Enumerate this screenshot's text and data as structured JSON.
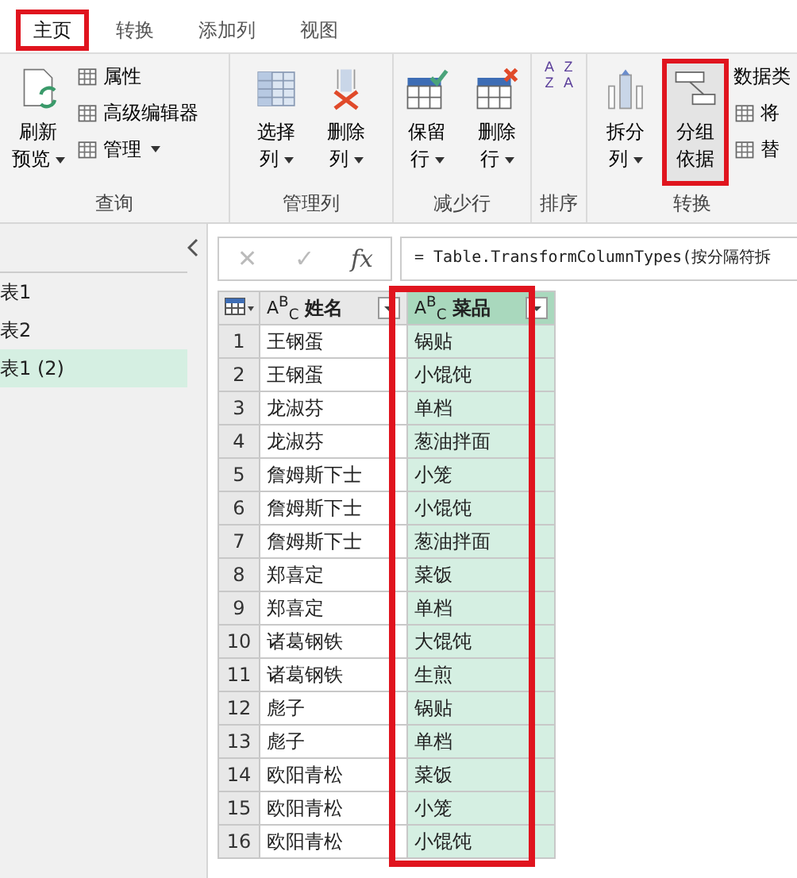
{
  "tabs": [
    {
      "label": "主页",
      "selected": true,
      "highlighted": true
    },
    {
      "label": "转换",
      "selected": false,
      "highlighted": false
    },
    {
      "label": "添加列",
      "selected": false,
      "highlighted": false
    },
    {
      "label": "视图",
      "selected": false,
      "highlighted": false
    }
  ],
  "ribbon": [
    {
      "label": "查询",
      "items": [
        {
          "kind": "large",
          "lines": [
            "刷新",
            "预览"
          ],
          "dropdown": true,
          "highlighted": false
        },
        {
          "kind": "small",
          "label": "属性",
          "dropdown": false
        },
        {
          "kind": "small",
          "label": "高级编辑器",
          "dropdown": false
        },
        {
          "kind": "small",
          "label": "管理",
          "dropdown": true
        }
      ]
    },
    {
      "label": "管理列",
      "items": [
        {
          "kind": "large",
          "lines": [
            "选择",
            "列"
          ],
          "dropdown": true,
          "highlighted": false
        },
        {
          "kind": "large",
          "lines": [
            "删除",
            "列"
          ],
          "dropdown": true,
          "highlighted": false
        }
      ]
    },
    {
      "label": "减少行",
      "items": [
        {
          "kind": "large",
          "lines": [
            "保留",
            "行"
          ],
          "dropdown": true,
          "highlighted": false
        },
        {
          "kind": "large",
          "lines": [
            "删除",
            "行"
          ],
          "dropdown": true,
          "highlighted": false
        }
      ]
    },
    {
      "label": "排序",
      "items": [
        {
          "kind": "sort",
          "top": "A",
          "bottom": "Z"
        },
        {
          "kind": "sort",
          "top": "Z",
          "bottom": "A"
        }
      ]
    },
    {
      "label": "转换",
      "items": [
        {
          "kind": "large",
          "lines": [
            "拆分",
            "列"
          ],
          "dropdown": true,
          "highlighted": false
        },
        {
          "kind": "large",
          "lines": [
            "分组",
            "依据"
          ],
          "dropdown": false,
          "highlighted": true
        },
        {
          "kind": "plain",
          "label": "数据类"
        },
        {
          "kind": "small",
          "label": "将",
          "dropdown": false
        },
        {
          "kind": "small",
          "label": "替",
          "dropdown": false
        }
      ]
    }
  ],
  "queries": {
    "items": [
      {
        "label": "表1",
        "selected": false
      },
      {
        "label": "表2",
        "selected": false
      },
      {
        "label": "表1 (2)",
        "selected": true
      }
    ]
  },
  "formula_bar": {
    "cancel": "✕",
    "confirm": "✓",
    "fx": "fx",
    "formula": "= Table.TransformColumnTypes(按分隔符拆"
  },
  "table": {
    "columns": [
      {
        "type": "A$^{B}$$_{C}$",
        "name": "姓名",
        "selected": false,
        "highlighted": false
      },
      {
        "type": "A$^{B}$$_{C}$",
        "name": "菜品",
        "selected": true,
        "highlighted": true
      }
    ],
    "rows": [
      {
        "row_number": "1",
        "cells": [
          "王钢蛋",
          "锅贴"
        ]
      },
      {
        "row_number": "2",
        "cells": [
          "王钢蛋",
          "小馄饨"
        ]
      },
      {
        "row_number": "3",
        "cells": [
          "龙淑芬",
          "单档"
        ]
      },
      {
        "row_number": "4",
        "cells": [
          "龙淑芬",
          "葱油拌面"
        ]
      },
      {
        "row_number": "5",
        "cells": [
          "詹姆斯下士",
          "小笼"
        ]
      },
      {
        "row_number": "6",
        "cells": [
          "詹姆斯下士",
          "小馄饨"
        ]
      },
      {
        "row_number": "7",
        "cells": [
          "詹姆斯下士",
          "葱油拌面"
        ]
      },
      {
        "row_number": "8",
        "cells": [
          "郑喜定",
          "菜饭"
        ]
      },
      {
        "row_number": "9",
        "cells": [
          "郑喜定",
          "单档"
        ]
      },
      {
        "row_number": "10",
        "cells": [
          "诸葛钢铁",
          "大馄饨"
        ]
      },
      {
        "row_number": "11",
        "cells": [
          "诸葛钢铁",
          "生煎"
        ]
      },
      {
        "row_number": "12",
        "cells": [
          "彪子",
          "锅贴"
        ]
      },
      {
        "row_number": "13",
        "cells": [
          "彪子",
          "单档"
        ]
      },
      {
        "row_number": "14",
        "cells": [
          "欧阳青松",
          "菜饭"
        ]
      },
      {
        "row_number": "15",
        "cells": [
          "欧阳青松",
          "小笼"
        ]
      },
      {
        "row_number": "16",
        "cells": [
          "欧阳青松",
          "小馄饨"
        ]
      }
    ]
  }
}
